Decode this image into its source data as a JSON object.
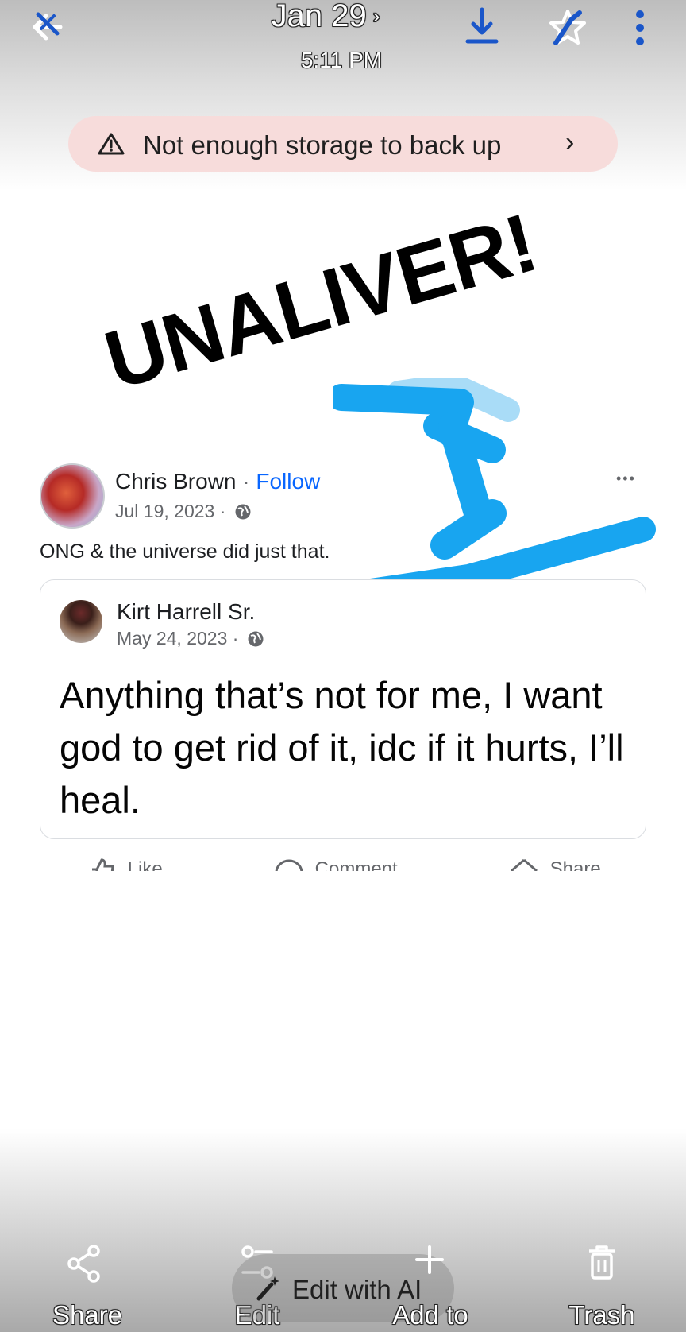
{
  "header": {
    "date": "Jan 29",
    "date_chevron": "›",
    "time": "5:11 PM"
  },
  "banner": {
    "text": "Not enough storage to back up",
    "chevron": "›"
  },
  "overlay": {
    "text": "UNALIVER!"
  },
  "post": {
    "author": "Chris Brown",
    "separator": " · ",
    "follow": "Follow",
    "date": "Jul 19, 2023 ·",
    "text": "ONG & the universe did just that.",
    "more": "•••"
  },
  "quoted": {
    "author": "Kirt Harrell Sr.",
    "date": "May 24, 2023 ·",
    "text": "Anything that’s not for me, I want god to get rid of it, idc if it hurts, I’ll heal."
  },
  "actions": {
    "like": "Like",
    "comment": "Comment",
    "share": "Share"
  },
  "bottom_bar": {
    "share": "Share",
    "edit": "Edit",
    "edit_ai": "Edit with AI",
    "add_to": "Add to",
    "trash": "Trash"
  },
  "colors": {
    "accent_blue": "#1a56c9",
    "follow_blue": "#0866ff",
    "marker_blue": "#18a5f0",
    "banner_bg": "#f7dcdb"
  },
  "icons": {
    "back": "back-arrow-icon",
    "download": "download-icon",
    "favorite": "star-icon",
    "more": "more-vertical-icon",
    "warning": "warning-icon",
    "globe": "globe-icon"
  }
}
